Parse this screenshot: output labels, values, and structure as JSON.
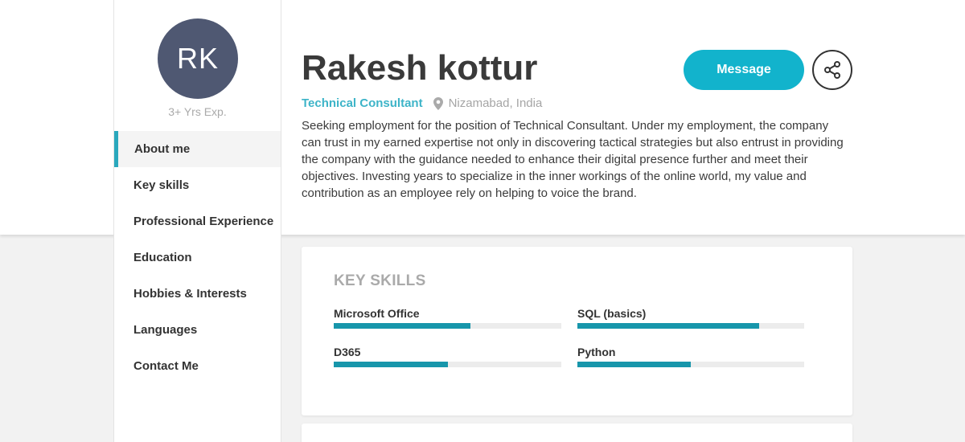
{
  "profile": {
    "initials": "RK",
    "experience": "3+ Yrs Exp.",
    "name": "Rakesh kottur",
    "role": "Technical Consultant",
    "location": "Nizamabad, India",
    "bio": "Seeking employment for the position of Technical Consultant. Under my employment, the company can trust in my earned expertise not only in discovering tactical strategies but also entrust in providing the company with the guidance needed to enhance their digital presence further and meet their objectives. Investing years to specialize in the inner workings of the online world, my value and contribution as an employee rely on helping to voice the brand."
  },
  "actions": {
    "message_label": "Message",
    "share_icon": "share-icon"
  },
  "sidebar": {
    "items": [
      {
        "label": "About me",
        "active": true
      },
      {
        "label": "Key skills",
        "active": false
      },
      {
        "label": "Professional Experience",
        "active": false
      },
      {
        "label": "Education",
        "active": false
      },
      {
        "label": "Hobbies & Interests",
        "active": false
      },
      {
        "label": "Languages",
        "active": false
      },
      {
        "label": "Contact Me",
        "active": false
      }
    ]
  },
  "skills": {
    "title": "KEY SKILLS",
    "items": [
      {
        "name": "Microsoft Office",
        "level": 0.6
      },
      {
        "name": "SQL (basics)",
        "level": 0.8
      },
      {
        "name": "D365",
        "level": 0.5
      },
      {
        "name": "Python",
        "level": 0.5
      }
    ]
  },
  "colors": {
    "accent": "#12b3cc",
    "role_text": "#3db4c8",
    "skill_fill": "#1796ab",
    "avatar_bg": "#4f5872"
  }
}
